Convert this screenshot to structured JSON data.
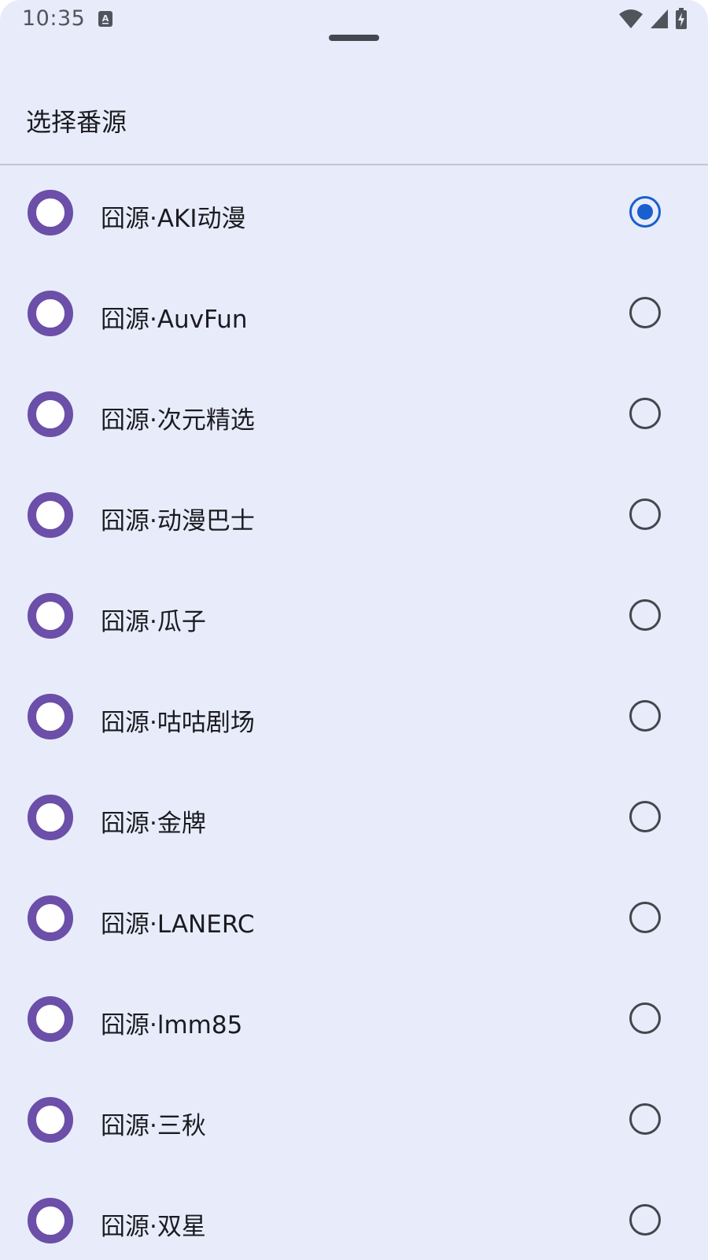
{
  "status_bar": {
    "time": "10:35",
    "notification_icon": "text-a-icon",
    "wifi_icon": "wifi-icon",
    "signal_icon": "cell-signal-icon",
    "battery_icon": "battery-charging-icon"
  },
  "sheet": {
    "title": "选择番源",
    "selected_index": 0,
    "items": [
      {
        "label": "囧源·AKI动漫",
        "selected": true
      },
      {
        "label": "囧源·AuvFun",
        "selected": false
      },
      {
        "label": "囧源·次元精选",
        "selected": false
      },
      {
        "label": "囧源·动漫巴士",
        "selected": false
      },
      {
        "label": "囧源·瓜子",
        "selected": false
      },
      {
        "label": "囧源·咕咕剧场",
        "selected": false
      },
      {
        "label": "囧源·金牌",
        "selected": false
      },
      {
        "label": "囧源·LANERC",
        "selected": false
      },
      {
        "label": "囧源·lmm85",
        "selected": false
      },
      {
        "label": "囧源·三秋",
        "selected": false
      },
      {
        "label": "囧源·双星",
        "selected": false
      }
    ]
  },
  "colors": {
    "sheet_background": "#e8ecfa",
    "avatar_ring": "#6b4fa8",
    "radio_selected": "#1a5fcf",
    "radio_unselected": "#44464e"
  }
}
